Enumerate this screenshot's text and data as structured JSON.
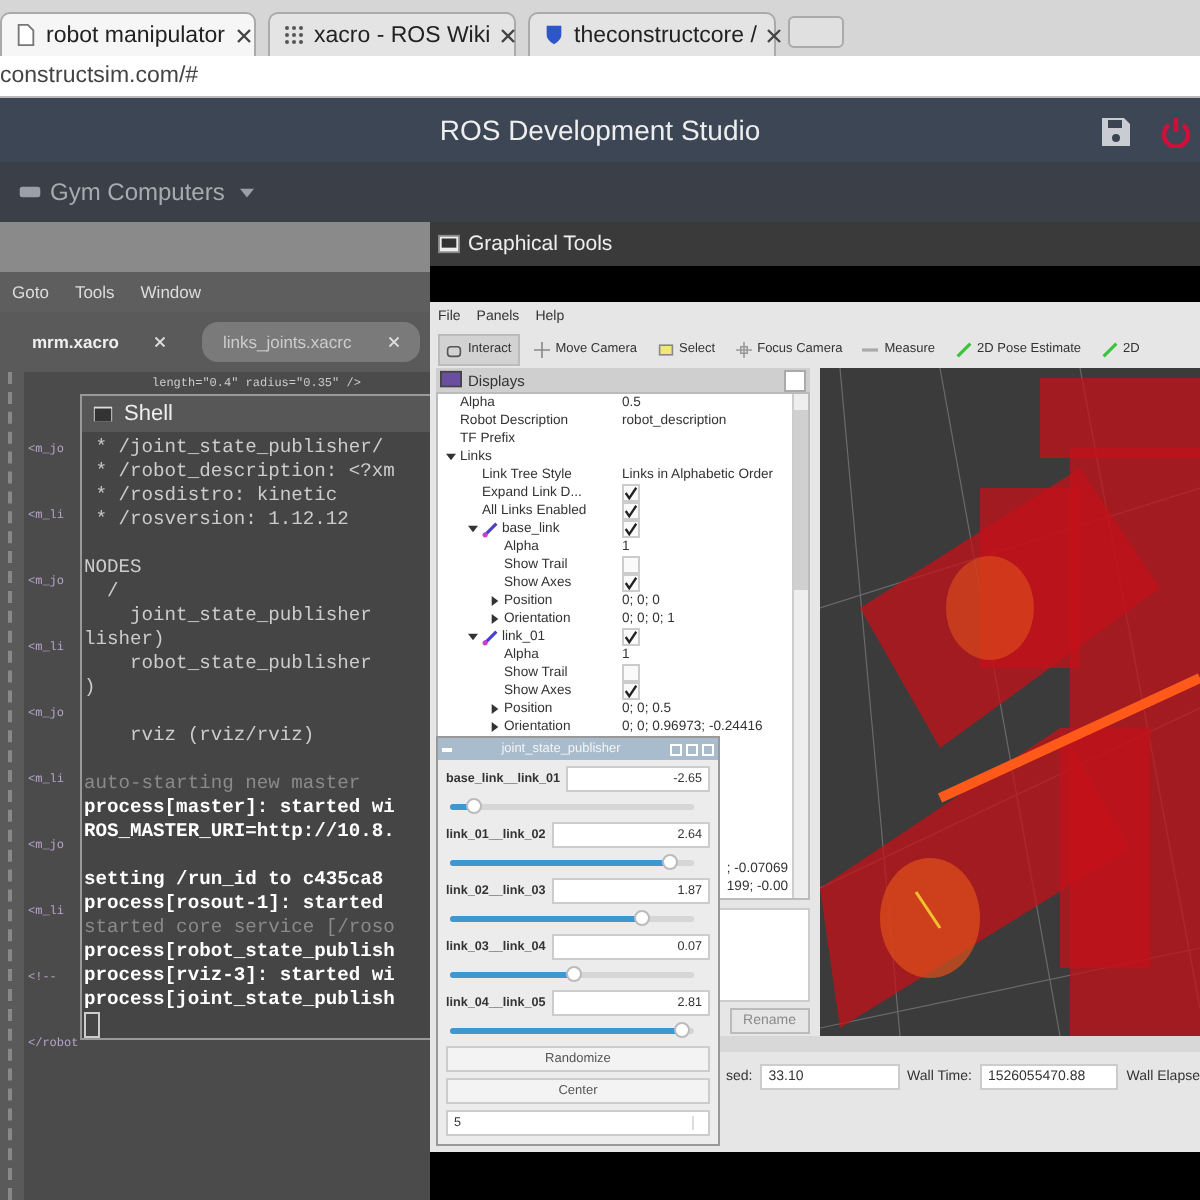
{
  "browser": {
    "tabs": [
      {
        "title": "robot manipulator",
        "selected": true
      },
      {
        "title": "xacro - ROS Wiki",
        "selected": false
      },
      {
        "title": "theconstructcore /",
        "selected": false
      }
    ],
    "address": "constructsim.com/#"
  },
  "header": {
    "title": "ROS Development Studio"
  },
  "subheader": {
    "menu": "Gym Computers"
  },
  "ide": {
    "menu": [
      "Goto",
      "Tools",
      "Window"
    ],
    "tabs": [
      {
        "label": "mrm.xacro",
        "selected": true
      },
      {
        "label": "links_joints.xacrc",
        "selected": false
      }
    ],
    "code_top": "length=\"0.4\" radius=\"0.35\" />",
    "code_lines": [
      "<m_jo",
      "<m_li",
      "<m_jo",
      "<m_li",
      "<m_jo",
      "<m_li",
      "<m_jo",
      "<m_li",
      "<!--",
      "</robot"
    ]
  },
  "shell": {
    "title": "Shell",
    "blocks": [
      [
        {
          "text": " * /joint_state_publisher/",
          "kind": "plain"
        },
        {
          "text": " * /robot_description: <?xm",
          "kind": "plain"
        },
        {
          "text": " * /rosdistro: kinetic",
          "kind": "plain"
        },
        {
          "text": " * /rosversion: 1.12.12",
          "kind": "plain"
        }
      ],
      [
        {
          "text": "NODES",
          "kind": "plain"
        },
        {
          "text": "  /",
          "kind": "plain"
        },
        {
          "text": "    joint_state_publisher",
          "kind": "plain"
        },
        {
          "text": "lisher)",
          "kind": "plain"
        },
        {
          "text": "    robot_state_publisher",
          "kind": "plain"
        },
        {
          "text": ")",
          "kind": "plain"
        }
      ],
      [
        {
          "text": "    rviz (rviz/rviz)",
          "kind": "plain"
        }
      ],
      [
        {
          "text": "auto-starting new master",
          "kind": "dim"
        },
        {
          "text": "process[master]: started wi",
          "kind": "bold"
        },
        {
          "text": "ROS_MASTER_URI=http://10.8.",
          "kind": "bold"
        }
      ],
      [
        {
          "text": "setting /run_id to c435ca8",
          "kind": "bold"
        },
        {
          "text": "process[rosout-1]: started",
          "kind": "bold"
        },
        {
          "text": "started core service [/roso",
          "kind": "dim"
        },
        {
          "text": "process[robot_state_publish",
          "kind": "bold"
        },
        {
          "text": "process[rviz-3]: started wi",
          "kind": "bold"
        },
        {
          "text": "process[joint_state_publish",
          "kind": "bold"
        }
      ]
    ]
  },
  "graphical_tools": {
    "title": "Graphical Tools",
    "menu": [
      "File",
      "Panels",
      "Help"
    ],
    "toolbar": [
      {
        "label": "Interact",
        "selected": true
      },
      {
        "label": "Move Camera",
        "selected": false
      },
      {
        "label": "Select",
        "selected": false
      },
      {
        "label": "Focus Camera",
        "selected": false
      },
      {
        "label": "Measure",
        "selected": false
      },
      {
        "label": "2D Pose Estimate",
        "selected": false
      },
      {
        "label": "2D",
        "selected": false
      }
    ],
    "displays": {
      "title": "Displays",
      "tree": [
        {
          "kind": "property",
          "name": "Alpha",
          "value": "0.5"
        },
        {
          "kind": "property",
          "name": "Robot Description",
          "value": "robot_description"
        },
        {
          "kind": "property",
          "name": "TF Prefix"
        },
        {
          "kind": "group",
          "name": "Links",
          "expanded": true,
          "children": [
            {
              "kind": "property",
              "name": "Link Tree Style",
              "value": "Links in Alphabetic Order"
            },
            {
              "kind": "property",
              "name": "Expand Link D...",
              "checked": true
            },
            {
              "kind": "property",
              "name": "All Links Enabled",
              "checked": true
            },
            {
              "kind": "link",
              "name": "base_link",
              "checked": true,
              "expanded": true,
              "children": [
                {
                  "kind": "property",
                  "name": "Alpha",
                  "value": "1"
                },
                {
                  "kind": "property",
                  "name": "Show Trail",
                  "checked": false
                },
                {
                  "kind": "property",
                  "name": "Show Axes",
                  "checked": true
                },
                {
                  "kind": "group",
                  "name": "Position",
                  "expanded": false,
                  "value": "0; 0; 0"
                },
                {
                  "kind": "group",
                  "name": "Orientation",
                  "expanded": false,
                  "value": "0; 0; 0; 1"
                }
              ]
            },
            {
              "kind": "link",
              "name": "link_01",
              "checked": true,
              "expanded": true,
              "children": [
                {
                  "kind": "property",
                  "name": "Alpha",
                  "value": "1"
                },
                {
                  "kind": "property",
                  "name": "Show Trail",
                  "checked": false
                },
                {
                  "kind": "property",
                  "name": "Show Axes",
                  "checked": true
                },
                {
                  "kind": "group",
                  "name": "Position",
                  "expanded": false,
                  "value": "0; 0; 0.5"
                },
                {
                  "kind": "group",
                  "name": "Orientation",
                  "expanded": false,
                  "value": "0; 0; 0.96973; -0.24416"
                }
              ]
            }
          ]
        }
      ],
      "covered_rows": [
        "; -0.07069",
        "199; -0.00"
      ],
      "rename": {
        "label": "Rename",
        "disabled": true
      }
    },
    "time_bar": [
      {
        "label": "sed:",
        "value": "33.10"
      },
      {
        "label": "Wall Time:",
        "value": "1526055470.88"
      },
      {
        "label": "Wall Elapse"
      }
    ]
  },
  "joint_state_publisher": {
    "title": "joint_state_publisher",
    "joints": [
      {
        "name": "base_link__link_01",
        "value": "-2.65",
        "level": 0.1
      },
      {
        "name": "link_01__link_02",
        "value": "2.64",
        "level": 0.9
      },
      {
        "name": "link_02__link_03",
        "value": "1.87",
        "level": 0.79
      },
      {
        "name": "link_03__link_04",
        "value": "0.07",
        "level": 0.51
      },
      {
        "name": "link_04__link_05",
        "value": "2.81",
        "level": 0.95
      }
    ],
    "buttons": [
      "Randomize",
      "Center"
    ],
    "spin_value": "5"
  }
}
